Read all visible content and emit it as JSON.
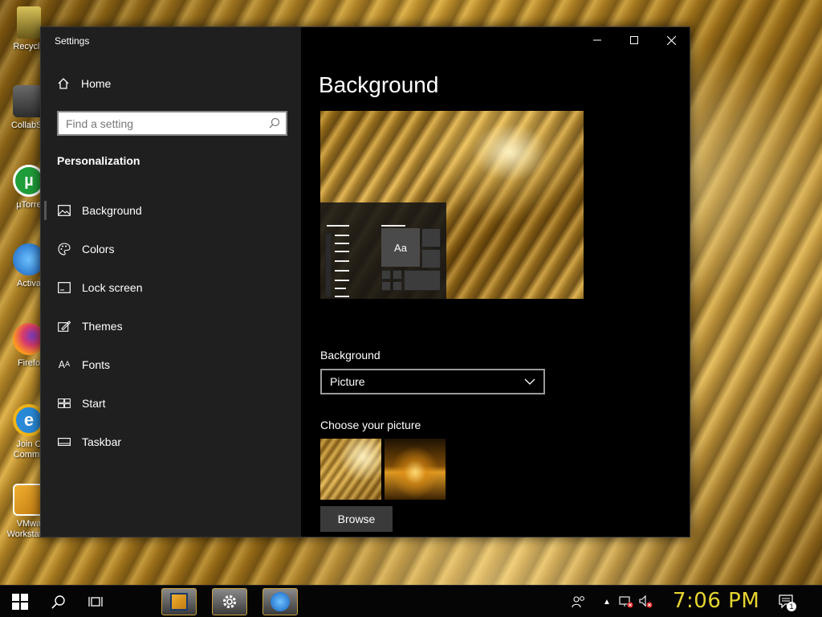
{
  "desktop": {
    "icons": [
      {
        "label": "Recycle",
        "icon": "recycle-bin-icon"
      },
      {
        "label": "CollabSy",
        "icon": "folder-icon"
      },
      {
        "label": "µTorre",
        "icon": "utorrent-icon"
      },
      {
        "label": "Activa",
        "icon": "activation-icon"
      },
      {
        "label": "Firefo",
        "icon": "firefox-icon"
      },
      {
        "label": "Join C Commu",
        "icon": "internet-explorer-icon"
      },
      {
        "label": "VMwa Workstati...",
        "icon": "vmware-icon"
      }
    ]
  },
  "window": {
    "title": "Settings",
    "controls": {
      "minimize": "minimize-icon",
      "maximize": "maximize-icon",
      "close": "close-icon"
    }
  },
  "sidebar": {
    "home_label": "Home",
    "search_placeholder": "Find a setting",
    "search_value": "",
    "section_title": "Personalization",
    "items": [
      {
        "label": "Background",
        "icon": "picture-icon",
        "active": true
      },
      {
        "label": "Colors",
        "icon": "palette-icon",
        "active": false
      },
      {
        "label": "Lock screen",
        "icon": "lock-screen-icon",
        "active": false
      },
      {
        "label": "Themes",
        "icon": "themes-icon",
        "active": false
      },
      {
        "label": "Fonts",
        "icon": "fonts-icon",
        "active": false
      },
      {
        "label": "Start",
        "icon": "start-icon",
        "active": false
      },
      {
        "label": "Taskbar",
        "icon": "taskbar-icon",
        "active": false
      }
    ]
  },
  "main": {
    "page_title": "Background",
    "preview_sample_text": "Aa",
    "background_label": "Background",
    "background_value": "Picture",
    "choose_picture_label": "Choose your picture",
    "browse_label": "Browse"
  },
  "taskbar": {
    "clock": "7:06 PM",
    "notification_count": "1",
    "accent_color": "#e5d530"
  }
}
